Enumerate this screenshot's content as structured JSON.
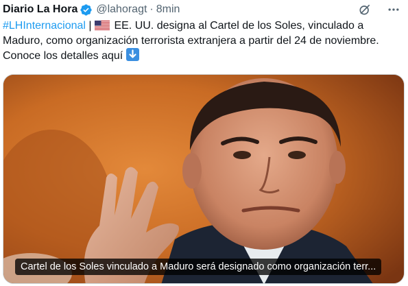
{
  "tweet": {
    "author_name": "Diario La Hora",
    "handle": "@lahoragt",
    "separator": "·",
    "time": "8min",
    "hashtag": "#LHInternacional",
    "text_after_hashtag": " | ",
    "text_main": " EE. UU. designa al Cartel de los Soles, vinculado a Maduro, como organización terrorista extranjera a partir del 24 de noviembre. Conoce los detalles aquí ",
    "icons": {
      "verified": "verified-badge-icon",
      "grok": "grok-icon",
      "more": "more-options-icon",
      "flag": "us-flag-emoji",
      "arrow": "down-arrow-emoji"
    }
  },
  "media": {
    "caption": "Cartel de los Soles vinculado a Maduro será designado como organización terr..."
  },
  "colors": {
    "accent": "#1d9bf0",
    "text": "#0f1419",
    "muted": "#536471"
  }
}
